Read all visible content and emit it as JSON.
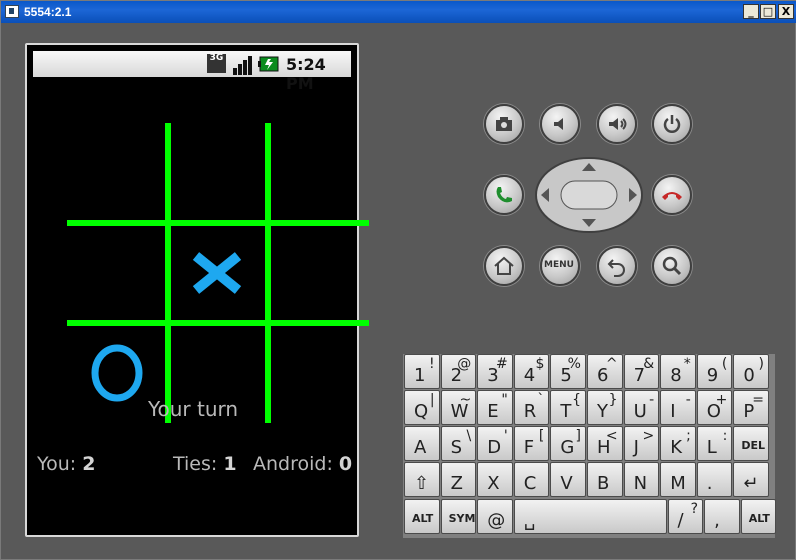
{
  "window": {
    "title": "5554:2.1",
    "minimize": "_",
    "maximize": "□",
    "close": "X"
  },
  "status_bar": {
    "network": "3G",
    "time": "5:24 PM"
  },
  "game": {
    "board": [
      [
        "",
        "",
        ""
      ],
      [
        "",
        "X",
        ""
      ],
      [
        "O",
        "",
        ""
      ]
    ],
    "colors": {
      "grid": "#00ff00",
      "pieces": "#1ea8f0"
    },
    "turn_label": "Your turn",
    "scores": [
      {
        "label": "You:",
        "value": "2"
      },
      {
        "label": "Ties:",
        "value": "1"
      },
      {
        "label": "Android:",
        "value": "0"
      }
    ]
  },
  "controls": {
    "buttons": [
      "camera-icon",
      "volume-down-icon",
      "volume-up-icon",
      "power-icon",
      "call-icon",
      "end-call-icon",
      "home-icon",
      "menu",
      "back-icon",
      "search-icon"
    ],
    "menu_label": "MENU"
  },
  "keyboard": {
    "row1": [
      [
        "1",
        "!"
      ],
      [
        "2",
        "@"
      ],
      [
        "3",
        "#"
      ],
      [
        "4",
        "$"
      ],
      [
        "5",
        "%"
      ],
      [
        "6",
        "^"
      ],
      [
        "7",
        "&"
      ],
      [
        "8",
        "*"
      ],
      [
        "9",
        "("
      ],
      [
        "0",
        ")"
      ]
    ],
    "row2": [
      [
        "Q",
        "|"
      ],
      [
        "W",
        "~"
      ],
      [
        "E",
        "\""
      ],
      [
        "R",
        "`"
      ],
      [
        "T",
        "{"
      ],
      [
        "Y",
        "}"
      ],
      [
        "U",
        "-"
      ],
      [
        "I",
        "-"
      ],
      [
        "O",
        "+"
      ],
      [
        "P",
        "="
      ]
    ],
    "row3": [
      [
        "A",
        ""
      ],
      [
        "S",
        "\\"
      ],
      [
        "D",
        "'"
      ],
      [
        "F",
        "["
      ],
      [
        "G",
        "]"
      ],
      [
        "H",
        "<"
      ],
      [
        "J",
        ">"
      ],
      [
        "K",
        ";"
      ],
      [
        "L",
        ":"
      ],
      [
        "DEL",
        ""
      ]
    ],
    "row4": [
      [
        "⇧",
        ""
      ],
      [
        "Z",
        ""
      ],
      [
        "X",
        ""
      ],
      [
        "C",
        ""
      ],
      [
        "V",
        ""
      ],
      [
        "B",
        ""
      ],
      [
        "N",
        ""
      ],
      [
        "M",
        ""
      ],
      [
        ".",
        ""
      ],
      [
        "↵",
        ""
      ]
    ],
    "row5": [
      [
        "ALT",
        ""
      ],
      [
        "SYM",
        ""
      ],
      [
        "@",
        ""
      ],
      [
        "␣",
        ""
      ],
      [
        "/",
        "?"
      ],
      [
        ",",
        ""
      ],
      [
        "ALT",
        ""
      ]
    ]
  }
}
